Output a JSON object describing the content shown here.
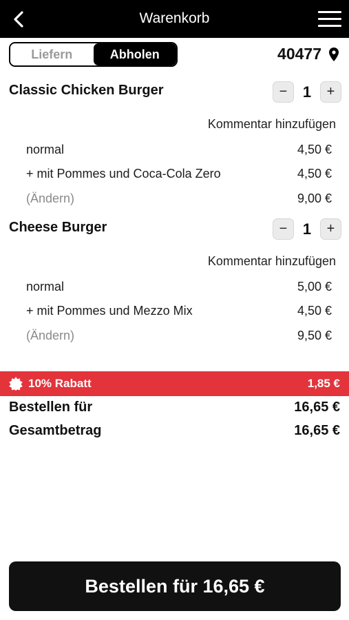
{
  "header": {
    "title": "Warenkorb"
  },
  "mode": {
    "deliver": "Liefern",
    "pickup": "Abholen"
  },
  "location": {
    "zip": "40477"
  },
  "items": [
    {
      "name": "Classic Chicken Burger",
      "qty": "1",
      "comment": "Kommentar hinzufügen",
      "lines": [
        {
          "label": "normal",
          "price": "4,50 €"
        },
        {
          "label": "+ mit Pommes und Coca-Cola Zero",
          "price": "4,50 €"
        },
        {
          "label": "(Ändern)",
          "price": "9,00 €"
        }
      ]
    },
    {
      "name": "Cheese Burger",
      "qty": "1",
      "comment": "Kommentar hinzufügen",
      "lines": [
        {
          "label": "normal",
          "price": "5,00 €"
        },
        {
          "label": "+ mit Pommes und Mezzo Mix",
          "price": "4,50 €"
        },
        {
          "label": "(Ändern)",
          "price": "9,50 €"
        }
      ]
    }
  ],
  "discount": {
    "label": "10% Rabatt",
    "amount": "1,85 €",
    "color": "#e3333b"
  },
  "summary": {
    "order_label": "Bestellen für",
    "order_value": "16,65 €",
    "total_label": "Gesamtbetrag",
    "total_value": "16,65 €"
  },
  "cta": {
    "label": "Bestellen für 16,65 €"
  },
  "icons": {
    "back": "chevron-left-icon",
    "menu": "hamburger-menu-icon",
    "location": "map-pin-icon",
    "discount": "badge-star-icon"
  }
}
